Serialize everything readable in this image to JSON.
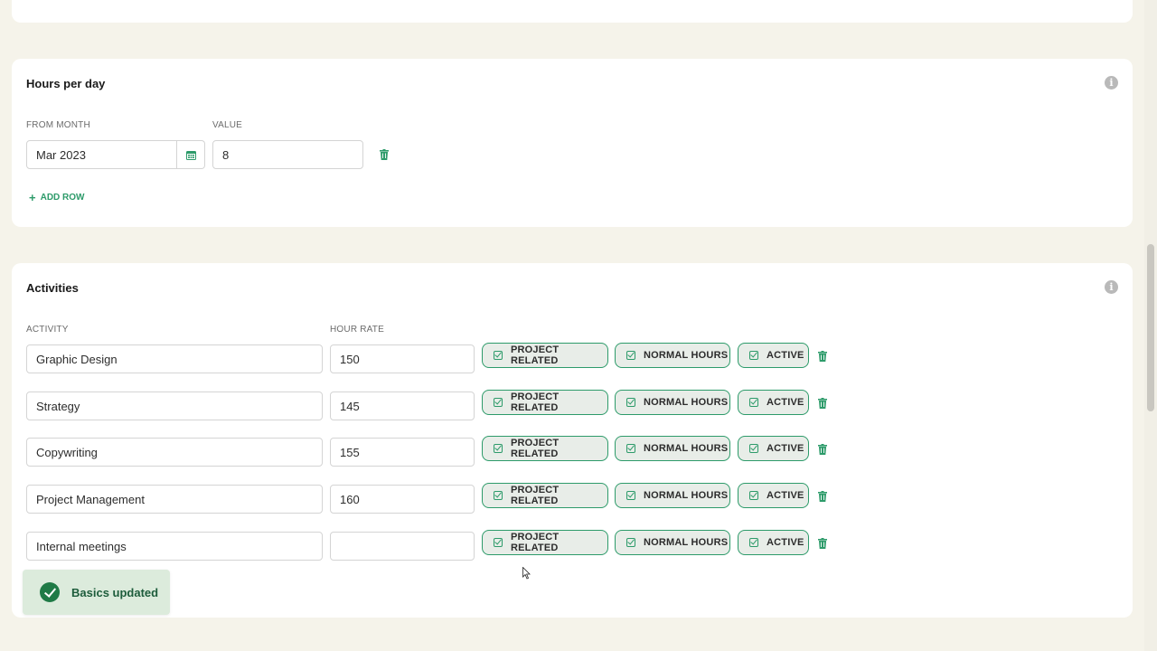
{
  "hours_card": {
    "title": "Hours per day",
    "from_month_label": "FROM MONTH",
    "value_label": "VALUE",
    "from_month_value": "Mar 2023",
    "value": "8",
    "add_row_label": "ADD ROW"
  },
  "activities_card": {
    "title": "Activities",
    "activity_label": "ACTIVITY",
    "hour_rate_label": "HOUR RATE",
    "tag_project": "PROJECT RELATED",
    "tag_normal": "NORMAL HOURS",
    "tag_active": "ACTIVE",
    "rows": [
      {
        "activity": "Graphic Design",
        "rate": "150"
      },
      {
        "activity": "Strategy",
        "rate": "145"
      },
      {
        "activity": "Copywriting",
        "rate": "155"
      },
      {
        "activity": "Project Management",
        "rate": "160"
      },
      {
        "activity": "Internal meetings",
        "rate": ""
      }
    ]
  },
  "toast": {
    "message": "Basics updated"
  },
  "colors": {
    "accent": "#2d9b6a",
    "background": "#f5f3ea",
    "toast_bg": "#dcebdc"
  }
}
